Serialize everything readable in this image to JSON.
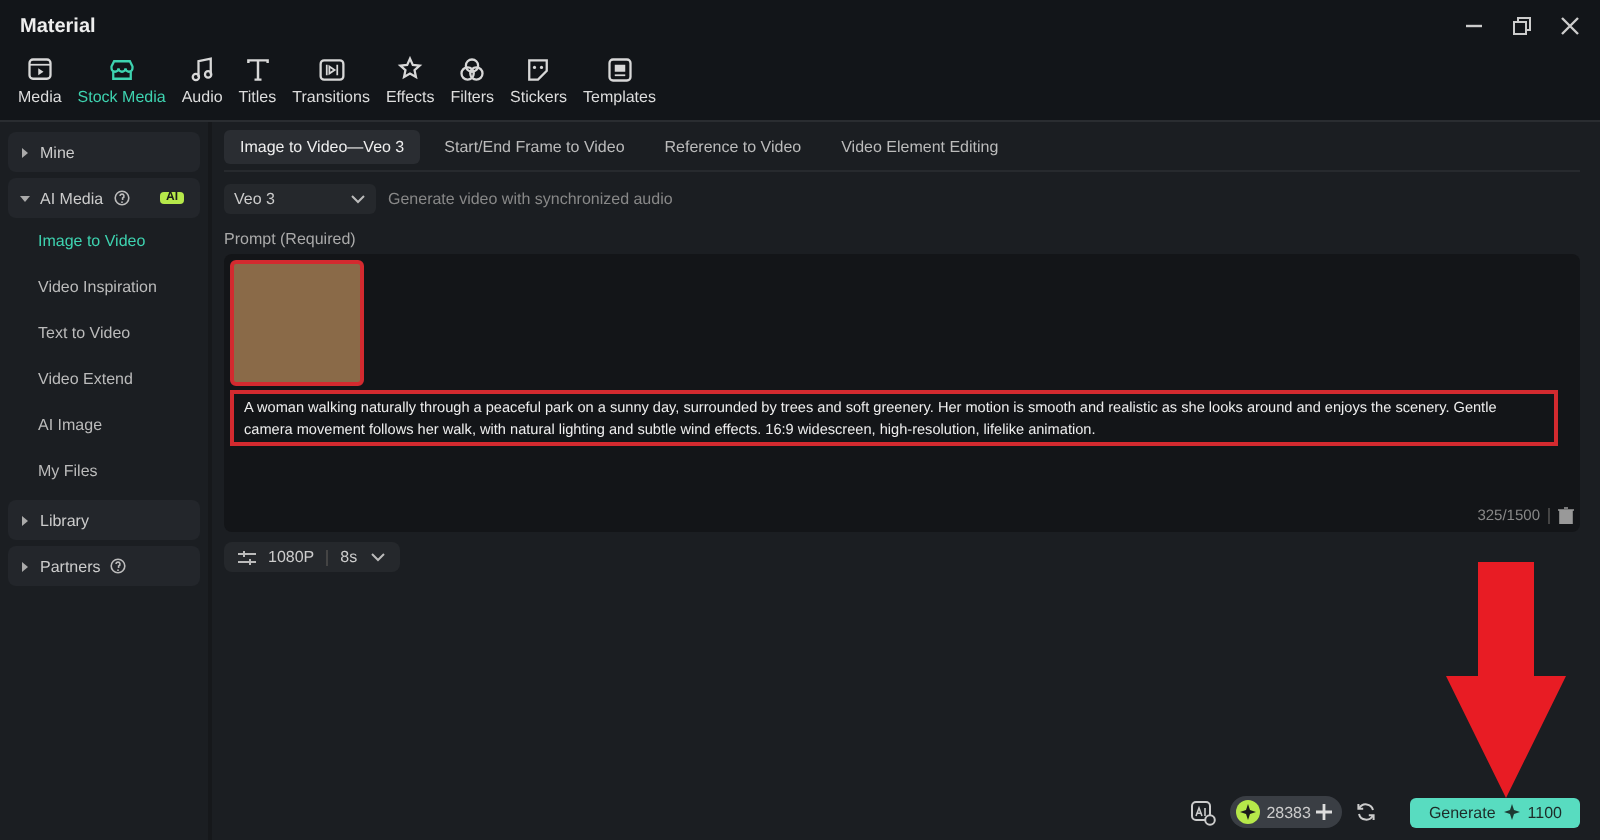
{
  "window": {
    "title": "Material"
  },
  "toolbar": [
    {
      "label": "Media",
      "selected": false
    },
    {
      "label": "Stock Media",
      "selected": true
    },
    {
      "label": "Audio",
      "selected": false
    },
    {
      "label": "Titles",
      "selected": false
    },
    {
      "label": "Transitions",
      "selected": false
    },
    {
      "label": "Effects",
      "selected": false
    },
    {
      "label": "Filters",
      "selected": false
    },
    {
      "label": "Stickers",
      "selected": false
    },
    {
      "label": "Templates",
      "selected": false
    }
  ],
  "sidebar": {
    "items": [
      {
        "label": "Mine",
        "expanded": false,
        "help": false
      },
      {
        "label": "AI Media",
        "expanded": true,
        "help": true,
        "badge": "AI",
        "children": [
          {
            "label": "Image to Video",
            "selected": true
          },
          {
            "label": "Video Inspiration",
            "selected": false
          },
          {
            "label": "Text to Video",
            "selected": false
          },
          {
            "label": "Video Extend",
            "selected": false
          },
          {
            "label": "AI Image",
            "selected": false
          },
          {
            "label": "My Files",
            "selected": false
          }
        ]
      },
      {
        "label": "Library",
        "expanded": false,
        "help": false
      },
      {
        "label": "Partners",
        "expanded": false,
        "help": true
      }
    ]
  },
  "tabs": [
    {
      "label": "Image to Video—Veo 3",
      "selected": true
    },
    {
      "label": "Start/End Frame to Video",
      "selected": false
    },
    {
      "label": "Reference to Video",
      "selected": false
    },
    {
      "label": "Video Element Editing",
      "selected": false
    }
  ],
  "model": {
    "value": "Veo 3",
    "hint": "Generate video with synchronized audio"
  },
  "prompt": {
    "label": "Prompt (Required)",
    "image_highlighted": true,
    "text_highlighted": true,
    "value": "A woman walking naturally through a peaceful park on a sunny day, surrounded by trees and soft greenery. Her motion is smooth and realistic as she looks around and enjoys the scenery. Gentle camera movement follows her walk, with natural lighting and subtle wind effects. 16:9 widescreen, high-resolution, lifelike animation.",
    "counter": "325/1500"
  },
  "settings": {
    "resolution": "1080P",
    "duration": "8s"
  },
  "footer": {
    "credits": "28383",
    "generate": {
      "label": "Generate",
      "cost": "1100",
      "pointer_arrow": true
    }
  }
}
